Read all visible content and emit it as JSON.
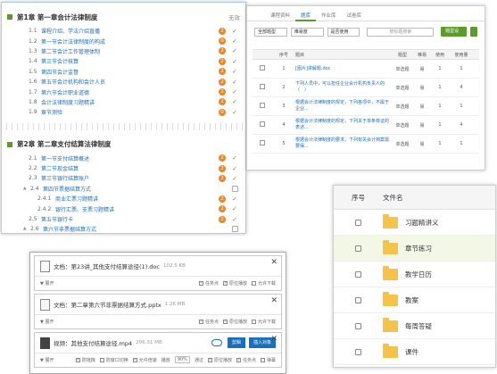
{
  "chapter_panel": {
    "chapter1": {
      "title": "第1章 第一章会计法律制度",
      "expand": "无效"
    },
    "chapter1_items": [
      {
        "num": "1.1",
        "label": "课程介绍、学法介绍直播",
        "badge": "2"
      },
      {
        "num": "1.2",
        "label": "第一节会计法律制度的构成",
        "badge": "0"
      },
      {
        "num": "1.3",
        "label": "第二节会计工作管理体制",
        "badge": "2"
      },
      {
        "num": "1.4",
        "label": "第三节会计核算",
        "badge": "2"
      },
      {
        "num": "1.5",
        "label": "第四节会计监督",
        "badge": "2"
      },
      {
        "num": "1.6",
        "label": "第五节会计机构和会计人员",
        "badge": "2"
      },
      {
        "num": "1.7",
        "label": "第六节会计职业道德",
        "badge": "2"
      },
      {
        "num": "1.8",
        "label": "会计法律制度习题精讲",
        "badge": "2"
      },
      {
        "num": "1.9",
        "label": "章节测验",
        "badge": "0"
      }
    ],
    "chapter2": {
      "title": "第2章 第二章支付结算法律制度"
    },
    "chapter2_items": [
      {
        "num": "2.1",
        "label": "第一节支付结算概述",
        "badge": "2",
        "type": "row"
      },
      {
        "num": "2.2",
        "label": "第二节现金结算",
        "badge": "2",
        "type": "row"
      },
      {
        "num": "2.3",
        "label": "第三节银行结算账户",
        "badge": "2",
        "type": "row"
      },
      {
        "num": "2.4",
        "label": "第四节票据结算方式",
        "badge": "",
        "type": "tri"
      },
      {
        "num": "2.4.1",
        "label": "商业汇票习题精讲",
        "badge": "2",
        "type": "sub"
      },
      {
        "num": "2.4.2",
        "label": "银行汇票、支票习题精讲",
        "badge": "2",
        "type": "sub"
      },
      {
        "num": "2.5",
        "label": "第五节银行卡",
        "badge": "2",
        "type": "row"
      },
      {
        "num": "2.6",
        "label": "第六节非票据结算方式",
        "badge": "",
        "type": "tri"
      }
    ]
  },
  "resource_panel": {
    "tabs": [
      "课程资料",
      "题库",
      "作业库",
      "试卷库"
    ],
    "active_tab": 1,
    "filters": {
      "type": "全部题型",
      "difficulty": "难易度",
      "used": "是否使用",
      "search_placeholder": "按标题搜索"
    },
    "add_button": "题型设置",
    "headers": [
      "",
      "序号",
      "题目",
      "题型",
      "难易",
      "使用",
      "使用量"
    ],
    "rows": [
      {
        "num": "1",
        "title": "[图片]讲解题.doc",
        "type": "单选题",
        "diff": "易",
        "use": "1",
        "count": "1"
      },
      {
        "num": "2",
        "title": "下列人员中，可以担任企业会计机构负责人的（　）",
        "type": "单选题",
        "diff": "易",
        "use": "1",
        "count": "4"
      },
      {
        "num": "3",
        "title": "根据会计法律制度的规定，下列各项中，不属于企业...",
        "type": "单选题",
        "diff": "易",
        "use": "1",
        "count": "1"
      },
      {
        "num": "4",
        "title": "根据会计法律制度的规定，下列关于单条核证的表述...",
        "type": "单选题",
        "diff": "易",
        "use": "1",
        "count": "4"
      },
      {
        "num": "5",
        "title": "根据会计法律制度的要求，下列有关会计档案需要保...",
        "type": "单选题",
        "diff": "易",
        "use": "1",
        "count": "1"
      }
    ]
  },
  "docs_panel": {
    "items": [
      {
        "kind": "file",
        "title": "文档：第23讲_其他支付结算途径(1).doc",
        "size": "102.5 KB",
        "expand": "展开",
        "opts": [
          "任务点",
          "原位播放",
          "允许下载"
        ]
      },
      {
        "kind": "file",
        "title": "文档：第二章第六节非票据结算方式.pptx",
        "size": "1.26 MB",
        "expand": "展开",
        "opts": [
          "任务点",
          "原位播放",
          "允许下载"
        ]
      },
      {
        "kind": "video",
        "title": "视频：其他支付结算途径.mp4",
        "size": "206.31 MB",
        "expand": "展开",
        "edit": "剪辑",
        "insert": "插入对象",
        "opts": [
          "防拖拽",
          "防窗口切换",
          "允许倍速",
          "播放",
          "90%",
          "通过",
          "原位播放",
          "任务点",
          "弹幕"
        ]
      }
    ]
  },
  "folder_panel": {
    "headers": [
      "序号",
      "文件名"
    ],
    "folders": [
      {
        "name": "习题精讲义",
        "highlight": false
      },
      {
        "name": "章节练习",
        "highlight": true
      },
      {
        "name": "教学日历",
        "highlight": false
      },
      {
        "name": "教案",
        "highlight": false
      },
      {
        "name": "每周答疑",
        "highlight": false
      },
      {
        "name": "课件",
        "highlight": false
      }
    ]
  },
  "colors": {
    "accent_green": "#5a9b2a",
    "badge_orange": "#e8862a",
    "link_blue": "#1b6eb8",
    "folder_yellow": "#f5c24a"
  }
}
